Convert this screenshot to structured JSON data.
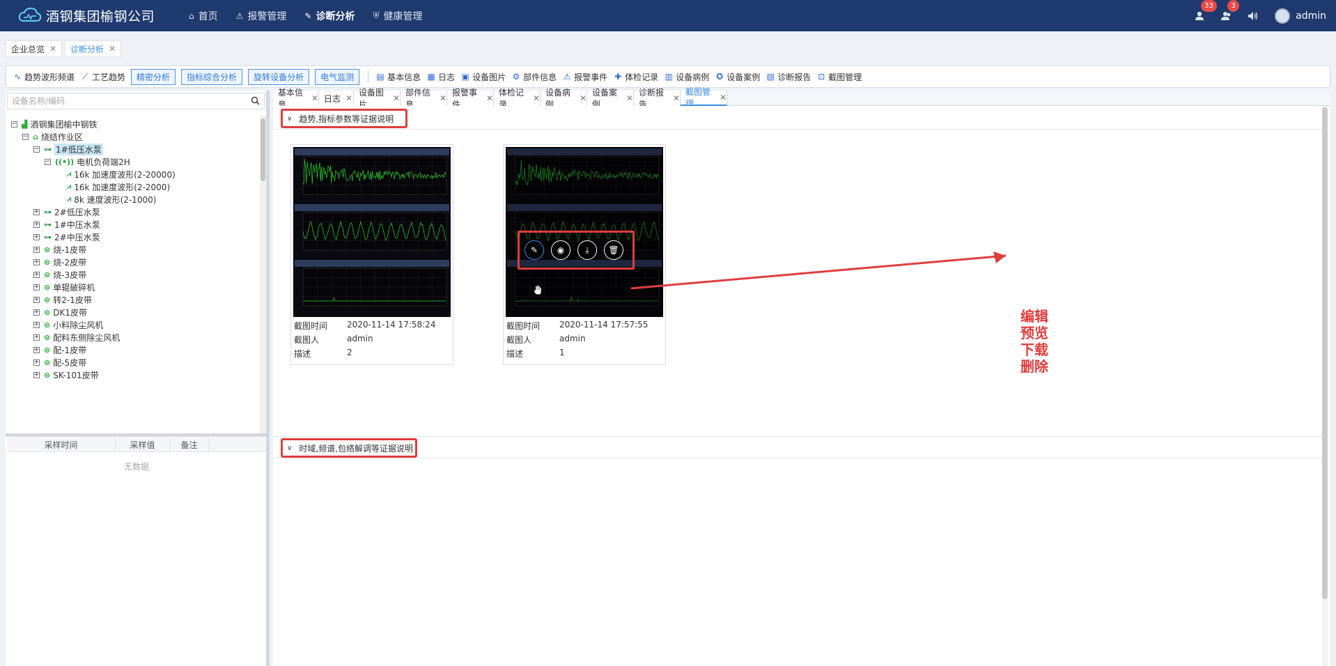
{
  "app": {
    "title": "酒钢集团榆钢公司"
  },
  "topnav": [
    {
      "label": "首页",
      "icon": "home-icon"
    },
    {
      "label": "报警管理",
      "icon": "alarm-icon"
    },
    {
      "label": "诊断分析",
      "icon": "wrench-icon",
      "active": true
    },
    {
      "label": "健康管理",
      "icon": "shield-icon"
    }
  ],
  "header": {
    "badge_alerts": "33",
    "badge_messages": "3",
    "user": "admin"
  },
  "page_tabs": [
    {
      "label": "企业总览"
    },
    {
      "label": "诊断分析",
      "active": true
    }
  ],
  "toolbar": {
    "items_left": [
      {
        "label": "趋势波形频谱",
        "icon": "waveform-icon"
      },
      {
        "label": "工艺趋势",
        "icon": "trend-chart-icon"
      }
    ],
    "buttons": [
      "精密分析",
      "指标综合分析",
      "旋转设备分析",
      "电气监测"
    ],
    "items_right": [
      {
        "label": "基本信息",
        "icon": "document-icon"
      },
      {
        "label": "日志",
        "icon": "log-icon"
      },
      {
        "label": "设备图片",
        "icon": "image-icon"
      },
      {
        "label": "部件信息",
        "icon": "parts-icon"
      },
      {
        "label": "报警事件",
        "icon": "alarm-icon"
      },
      {
        "label": "体检记录",
        "icon": "checkup-icon"
      },
      {
        "label": "设备病例",
        "icon": "medical-record-icon"
      },
      {
        "label": "设备案例",
        "icon": "star-icon"
      },
      {
        "label": "诊断报告",
        "icon": "report-icon"
      },
      {
        "label": "截图管理",
        "icon": "screenshot-icon"
      }
    ]
  },
  "search": {
    "placeholder": "设备名称/编码"
  },
  "tree": [
    {
      "label": "酒钢集团榆中钢铁",
      "level": 0,
      "exp": "−",
      "icon": "factory-icon"
    },
    {
      "label": "烧结作业区",
      "level": 1,
      "exp": "−",
      "icon": "area-icon"
    },
    {
      "label": "1#低压水泵",
      "level": 2,
      "exp": "−",
      "icon": "pump-icon",
      "selected": true
    },
    {
      "label": "电机负荷端2H",
      "level": 3,
      "exp": "−",
      "icon": "sensor-icon"
    },
    {
      "label": "16k 加速度波形(2-20000)",
      "level": 4,
      "icon": "wave-icon"
    },
    {
      "label": "16k 加速度波形(2-2000)",
      "level": 4,
      "icon": "wave-icon"
    },
    {
      "label": "8k 速度波形(2-1000)",
      "level": 4,
      "icon": "wave-icon"
    },
    {
      "label": "2#低压水泵",
      "level": 2,
      "exp": "+",
      "icon": "pump-icon"
    },
    {
      "label": "1#中压水泵",
      "level": 2,
      "exp": "+",
      "icon": "pump-icon"
    },
    {
      "label": "2#中压水泵",
      "level": 2,
      "exp": "+",
      "icon": "pump-icon"
    },
    {
      "label": "烧-1皮带",
      "level": 2,
      "exp": "+",
      "icon": "belt-icon"
    },
    {
      "label": "烧-2皮带",
      "level": 2,
      "exp": "+",
      "icon": "belt-icon"
    },
    {
      "label": "烧-3皮带",
      "level": 2,
      "exp": "+",
      "icon": "belt-icon"
    },
    {
      "label": "单辊破碎机",
      "level": 2,
      "exp": "+",
      "icon": "belt-icon"
    },
    {
      "label": "转2-1皮带",
      "level": 2,
      "exp": "+",
      "icon": "belt-icon"
    },
    {
      "label": "DK1皮带",
      "level": 2,
      "exp": "+",
      "icon": "belt-icon"
    },
    {
      "label": "小料除尘风机",
      "level": 2,
      "exp": "+",
      "icon": "belt-icon"
    },
    {
      "label": "配料东侧除尘风机",
      "level": 2,
      "exp": "+",
      "icon": "belt-icon"
    },
    {
      "label": "配-1皮带",
      "level": 2,
      "exp": "+",
      "icon": "belt-icon"
    },
    {
      "label": "配-5皮带",
      "level": 2,
      "exp": "+",
      "icon": "belt-icon"
    },
    {
      "label": "SK-101皮带",
      "level": 2,
      "exp": "+",
      "icon": "belt-icon"
    }
  ],
  "sample_table": {
    "columns": [
      "采样时间",
      "采样值",
      "备注"
    ],
    "empty": "无数据"
  },
  "sub_tabs": [
    {
      "label": "基本信息"
    },
    {
      "label": "日志"
    },
    {
      "label": "设备图片"
    },
    {
      "label": "部件信息"
    },
    {
      "label": "报警事件"
    },
    {
      "label": "体检记录"
    },
    {
      "label": "设备病例"
    },
    {
      "label": "设备案例"
    },
    {
      "label": "诊断报告"
    },
    {
      "label": "截图管理",
      "active": true
    }
  ],
  "sections": [
    {
      "title": "趋势,指标参数等证据说明"
    },
    {
      "title": "时域,频谱,包络解调等证据说明"
    }
  ],
  "cards": [
    {
      "time_label": "截图时间",
      "time": "2020-11-14 17:58:24",
      "user_label": "截图人",
      "user": "admin",
      "desc_label": "描述",
      "desc": "2"
    },
    {
      "time_label": "截图时间",
      "time": "2020-11-14 17:57:55",
      "user_label": "截图人",
      "user": "admin",
      "desc_label": "描述",
      "desc": "1"
    }
  ],
  "card_actions": [
    "edit-icon",
    "preview-icon",
    "download-icon",
    "delete-icon"
  ],
  "annotation": [
    "编辑",
    "预览",
    "下载",
    "删除"
  ],
  "colors": {
    "header_bg": "#1e3a6e",
    "accent": "#3a8ee6",
    "highlight_red": "#e03d3d",
    "wave_green": "#2fd02f"
  }
}
